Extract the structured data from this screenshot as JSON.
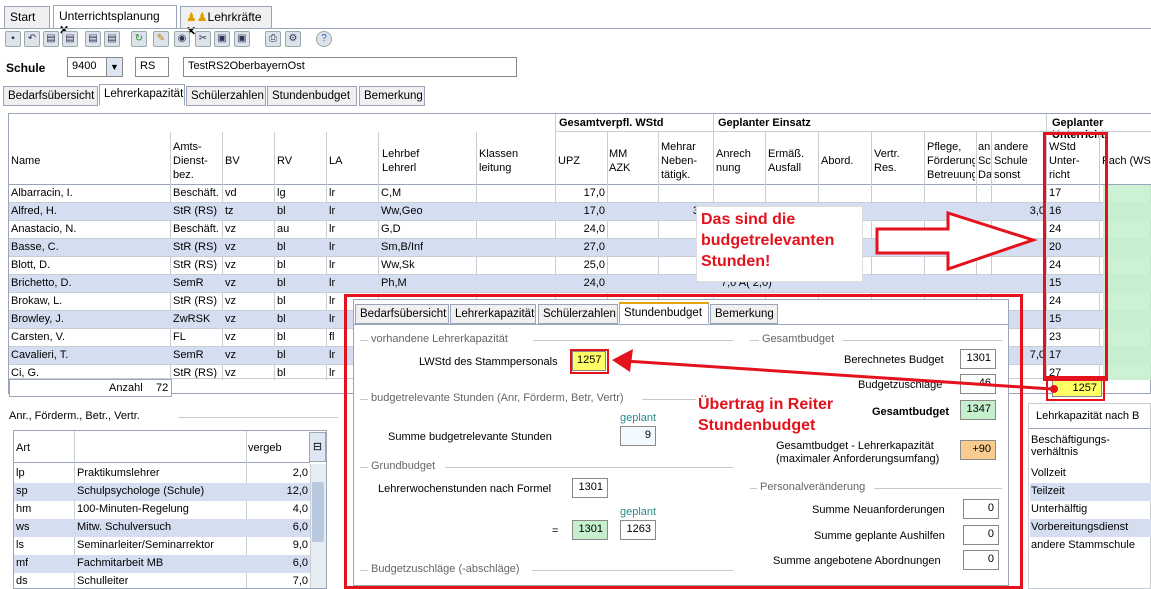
{
  "tabs": [
    {
      "label": "Start"
    },
    {
      "label": "Unterrichtsplanung"
    },
    {
      "label": "Lehrkräfte"
    }
  ],
  "school": {
    "label": "Schule",
    "number": "9400",
    "type": "RS",
    "name": "TestRS2OberbayernOst"
  },
  "subtabs": [
    "Bedarfsübersicht",
    "Lehrerkapazität",
    "Schülerzahlen",
    "Stundenbudget",
    "Bemerkung"
  ],
  "table": {
    "group_headers": {
      "gesamt": "Gesamtverpfl. WStd",
      "einsatz": "Geplanter Einsatz",
      "unterricht": "Geplanter Unterricht"
    },
    "columns": {
      "name": "Name",
      "amts": "Amts-\nDienst-\nbez.",
      "bv": "BV",
      "rv": "RV",
      "la": "LA",
      "lehrbef": "Lehrbef\nLehrerl",
      "klassen": "Klassen\nleitung",
      "upz": "UPZ",
      "mm": "MM\nAZK",
      "mehrar": "Mehrar\nNeben-\ntätigk.",
      "anrech": "Anrech\nnung",
      "ermaess": "Ermäß.\nAusfall",
      "abord": "Abord.",
      "vertr": "Vertr.\nRes.",
      "pflege": "Pflege,\nFörderung\nBetreuung",
      "an": "an\nSc\nDa",
      "andere": "andere\nSchule\nsonst",
      "wstd": "WStd\nUnter-\nricht",
      "fach": "Fach (WSt"
    },
    "rows": [
      {
        "name": "Albarracin, I.",
        "amts": "Beschäft.",
        "bv": "vd",
        "rv": "lg",
        "la": "lr",
        "lehrbef": "C,M",
        "upz": "17,0",
        "mehrar": "",
        "anrech": "",
        "andere": "",
        "wstd": "17"
      },
      {
        "name": "Alfred, H.",
        "amts": "StR (RS)",
        "bv": "tz",
        "rv": "bl",
        "la": "lr",
        "lehrbef": "Ww,Geo",
        "upz": "17,0",
        "mehrar": "3",
        "anrech": "",
        "andere": "3,0",
        "wstd": "16"
      },
      {
        "name": "Anastacio, N.",
        "amts": "Beschäft.",
        "bv": "vz",
        "rv": "au",
        "la": "lr",
        "lehrbef": "G,D",
        "upz": "24,0",
        "mehrar": "",
        "anrech": "",
        "andere": "",
        "wstd": "24"
      },
      {
        "name": "Basse, C.",
        "amts": "StR (RS)",
        "bv": "vz",
        "rv": "bl",
        "la": "lr",
        "lehrbef": "Sm,B/Inf",
        "upz": "27,0",
        "mehrar": "",
        "anrech": "",
        "andere": "",
        "wstd": "20"
      },
      {
        "name": "Blott, D.",
        "amts": "StR (RS)",
        "bv": "vz",
        "rv": "bl",
        "la": "lr",
        "lehrbef": "Ww,Sk",
        "upz": "25,0",
        "mehrar": "",
        "anrech": "",
        "andere": "",
        "wstd": "24"
      },
      {
        "name": "Brichetto, D.",
        "amts": "SemR",
        "bv": "vz",
        "rv": "bl",
        "la": "lr",
        "lehrbef": "Ph,M",
        "upz": "24,0",
        "mehrar": "",
        "anrech": "7,0 A( 2,0)",
        "andere": "",
        "wstd": "15"
      },
      {
        "name": "Brokaw, L.",
        "amts": "StR (RS)",
        "bv": "vz",
        "rv": "bl",
        "la": "lr",
        "lehrbef": "",
        "upz": "",
        "mehrar": "",
        "anrech": "",
        "andere": "",
        "wstd": "24"
      },
      {
        "name": "Browley, J.",
        "amts": "ZwRSK",
        "bv": "vz",
        "rv": "bl",
        "la": "lr",
        "lehrbef": "",
        "upz": "",
        "mehrar": "",
        "anrech": "",
        "andere": "",
        "wstd": "15"
      },
      {
        "name": "Carsten, V.",
        "amts": "FL",
        "bv": "vz",
        "rv": "bl",
        "la": "fl",
        "lehrbef": "",
        "upz": "",
        "mehrar": "",
        "anrech": "",
        "andere": "",
        "wstd": "23"
      },
      {
        "name": "Cavalieri, T.",
        "amts": "SemR",
        "bv": "vz",
        "rv": "bl",
        "la": "lr",
        "lehrbef": "",
        "upz": "",
        "mehrar": "",
        "anrech": "",
        "andere": "7,0",
        "wstd": "17"
      },
      {
        "name": "Ci, G.",
        "amts": "StR (RS)",
        "bv": "vz",
        "rv": "bl",
        "la": "lr",
        "lehrbef": "",
        "upz": "",
        "mehrar": "",
        "anrech": "",
        "andere": "",
        "wstd": "27"
      }
    ],
    "count_label": "Anzahl",
    "count_value": "72",
    "sum_wstd": "1257"
  },
  "left_panel": {
    "title": "Anr., Förderm., Betr., Vertr.",
    "headers": {
      "art": "Art",
      "vergeb": "vergeb"
    },
    "rows": [
      {
        "code": "lp",
        "desc": "Praktikumslehrer",
        "value": "2,0"
      },
      {
        "code": "sp",
        "desc": "Schulpsychologe (Schule)",
        "value": "12,0"
      },
      {
        "code": "hm",
        "desc": "100-Minuten-Regelung",
        "value": "4,0"
      },
      {
        "code": "ws",
        "desc": "Mitw. Schulversuch",
        "value": "6,0"
      },
      {
        "code": "ls",
        "desc": "Seminarleiter/Seminarrektor",
        "value": "9,0"
      },
      {
        "code": "mf",
        "desc": "Fachmitarbeit MB",
        "value": "6,0"
      },
      {
        "code": "ds",
        "desc": "Schulleiter",
        "value": "7,0"
      }
    ]
  },
  "right_panel": {
    "title": "Lehrkapazität nach B",
    "rows": [
      "Beschäftigungs-\nverhältnis",
      "Vollzeit",
      "Teilzeit",
      "Unterhälftig",
      "Vorbereitungsdienst",
      "andere Stammschule"
    ]
  },
  "overlay": {
    "tabs": [
      "Bedarfsübersicht",
      "Lehrerkapazität",
      "Schülerzahlen",
      "Stundenbudget",
      "Bemerkung"
    ],
    "vorhandene_title": "vorhandene Lehrerkapazität",
    "lwstd_label": "LWStd des Stammpersonals",
    "lwstd_value": "1257",
    "budgetrel_title": "budgetrelevante Stunden (Anr, Förderm, Betr, Vertr)",
    "geplant_label": "geplant",
    "summe_budgetrel_label": "Summe budgetrelevante Stunden",
    "summe_budgetrel_value": "9",
    "grundbudget_title": "Grundbudget",
    "lehrerwoch_label": "Lehrerwochenstunden nach Formel",
    "lehrerwoch_value": "1301",
    "equals": "=",
    "grund_value": "1301",
    "geplant2_label": "geplant",
    "grund_geplant": "1263",
    "zuschlaege_title": "Budgetzuschläge (-abschläge)",
    "gesamtbudget_title": "Gesamtbudget",
    "berechnet_label": "Berechnetes Budget",
    "berechnet_value": "1301",
    "zuschlaege_label": "Budgetzuschläge",
    "zuschlaege_value": "46",
    "gesamt_label": "Gesamtbudget",
    "gesamt_value": "1347",
    "diff_label": "Gesamtbudget - Lehrerkapazität\n(maximaler Anforderungsumfang)",
    "diff_value": "+90",
    "personal_title": "Personalveränderung",
    "neuanf_label": "Summe Neuanforderungen",
    "neuanf_value": "0",
    "aushilfen_label": "Summe geplante Aushilfen",
    "aushilfen_value": "0",
    "abord_label": "Summe angebotene Abordnungen",
    "abord_value": "0"
  },
  "annotations": {
    "callout1": "Das sind die\nbudgetrelevanten\nStunden!",
    "callout2": "Übertrag in Reiter\nStundenbudget"
  },
  "colors": {
    "accent_red": "#e3121c",
    "row_alt": "#d5def0",
    "yellow": "#ffff66",
    "green": "#c6efce",
    "orange": "#f9cb8e"
  }
}
